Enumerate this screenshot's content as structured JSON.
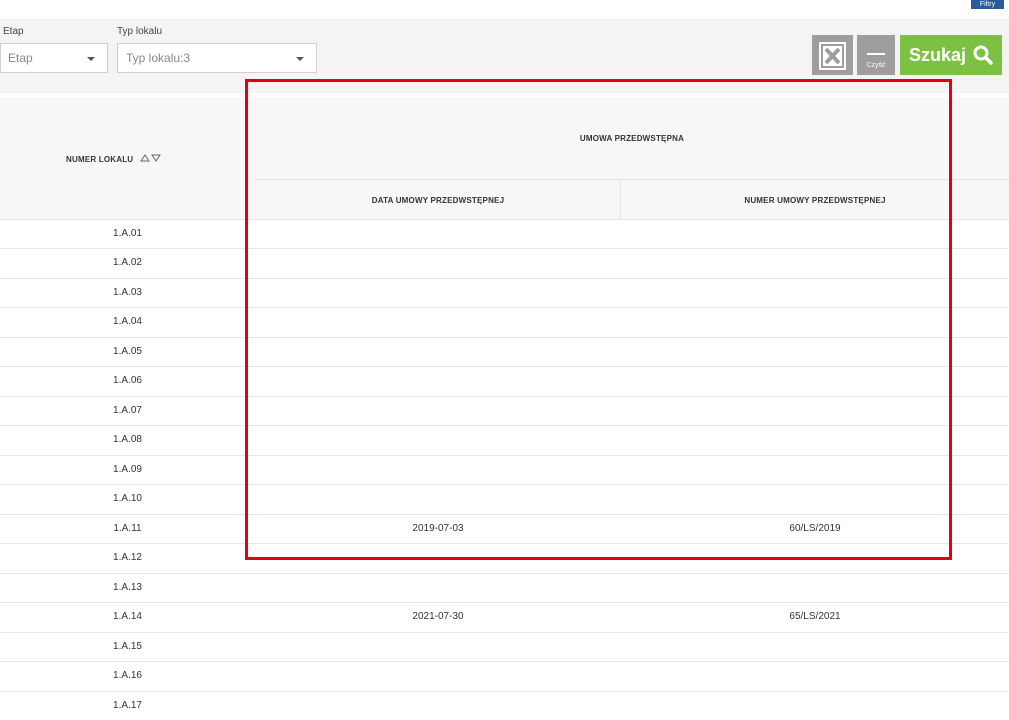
{
  "filtry_tab": "Filtry",
  "filters": {
    "etap_label": "Etap",
    "etap_value": "Etap",
    "typ_label": "Typ lokalu",
    "typ_value": "Typ lokalu:3"
  },
  "actions": {
    "clear_label": "Czyść",
    "search_label": "Szukaj"
  },
  "table": {
    "col_numer": "NUMER LOKALU",
    "group_header": "UMOWA PRZEDWSTĘPNA",
    "col_data": "DATA UMOWY PRZEDWSTĘPNEJ",
    "col_numer_umowy": "NUMER UMOWY PRZEDWSTĘPNEJ",
    "rows": [
      {
        "numer": "1.A.01",
        "data": "",
        "umowa": ""
      },
      {
        "numer": "1.A.02",
        "data": "",
        "umowa": ""
      },
      {
        "numer": "1.A.03",
        "data": "",
        "umowa": ""
      },
      {
        "numer": "1.A.04",
        "data": "",
        "umowa": ""
      },
      {
        "numer": "1.A.05",
        "data": "",
        "umowa": ""
      },
      {
        "numer": "1.A.06",
        "data": "",
        "umowa": ""
      },
      {
        "numer": "1.A.07",
        "data": "",
        "umowa": ""
      },
      {
        "numer": "1.A.08",
        "data": "",
        "umowa": ""
      },
      {
        "numer": "1.A.09",
        "data": "",
        "umowa": ""
      },
      {
        "numer": "1.A.10",
        "data": "",
        "umowa": ""
      },
      {
        "numer": "1.A.11",
        "data": "2019-07-03",
        "umowa": "60/LS/2019"
      },
      {
        "numer": "1.A.12",
        "data": "",
        "umowa": ""
      },
      {
        "numer": "1.A.13",
        "data": "",
        "umowa": ""
      },
      {
        "numer": "1.A.14",
        "data": "2021-07-30",
        "umowa": "65/LS/2021"
      },
      {
        "numer": "1.A.15",
        "data": "",
        "umowa": ""
      },
      {
        "numer": "1.A.16",
        "data": "",
        "umowa": ""
      },
      {
        "numer": "1.A.17",
        "data": "",
        "umowa": ""
      }
    ]
  },
  "colors": {
    "search_green": "#7cc142",
    "button_gray": "#9e9e9e",
    "highlight_red": "#e3000f",
    "tab_blue": "#2a5a9a"
  }
}
